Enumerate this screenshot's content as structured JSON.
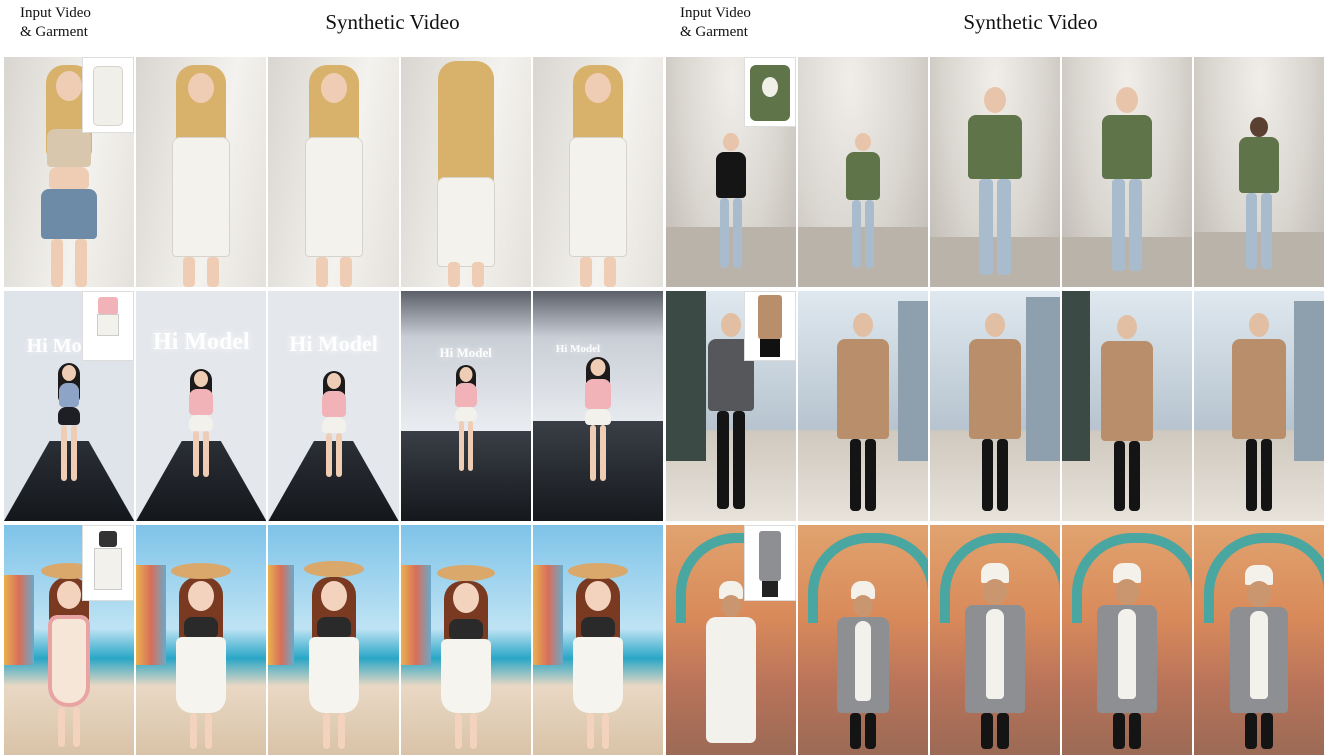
{
  "headers": [
    {
      "label_line1": "Input Video",
      "label_line2": "& Garment",
      "title": "Synthetic Video"
    },
    {
      "label_line1": "Input Video",
      "label_line2": "& Garment",
      "title": "Synthetic Video"
    }
  ],
  "scene_text": {
    "hi_model": "Hi Model",
    "hi_model_cut": "Hi Mo"
  },
  "colors": {
    "studio_bg": "#e9e7e4",
    "white_dress": "#f3f1ec",
    "green_sweater": "#5f7448",
    "camel_coat": "#b88f6a",
    "grey_coat": "#8d8f92",
    "pink_tee": "#f2b3b8",
    "beach_sky": "#7ec3e8",
    "market_wall": "#d98a5a"
  }
}
